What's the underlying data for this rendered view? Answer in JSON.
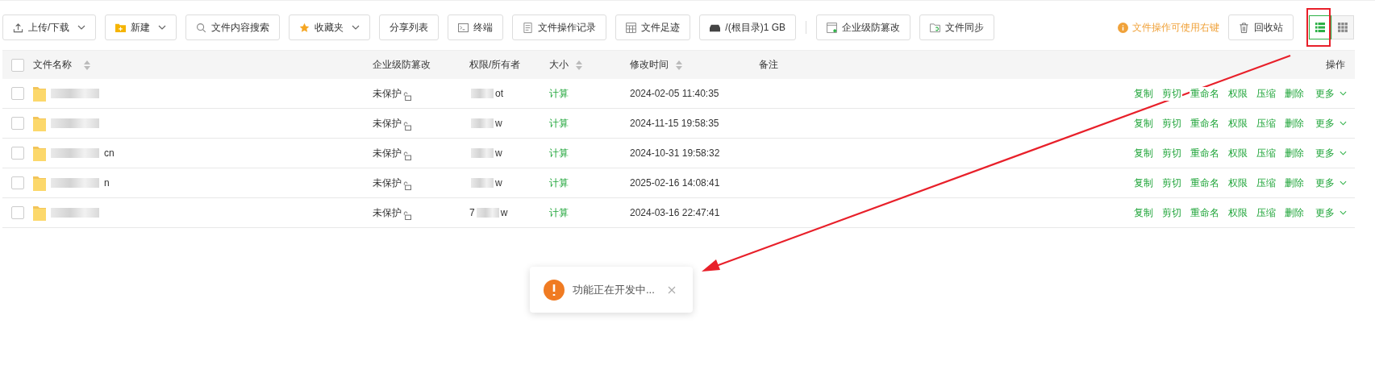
{
  "toolbar": {
    "buttons": [
      {
        "label": "上传/下载",
        "caret": true,
        "divider_before": false
      },
      {
        "label": "新建",
        "caret": true,
        "divider_before": false
      },
      {
        "label": "文件内容搜索",
        "caret": false,
        "divider_before": false
      },
      {
        "label": "收藏夹",
        "caret": true,
        "divider_before": false
      },
      {
        "label": "分享列表",
        "caret": false,
        "divider_before": false
      },
      {
        "label": "终端",
        "caret": false,
        "divider_before": false
      },
      {
        "label": "文件操作记录",
        "caret": false,
        "divider_before": false
      },
      {
        "label": "文件足迹",
        "caret": false,
        "divider_before": false
      },
      {
        "label": "/(根目录)1 GB",
        "caret": false,
        "divider_before": false
      },
      {
        "label": "企业级防篡改",
        "caret": false,
        "divider_before": true
      },
      {
        "label": "文件同步",
        "caret": false,
        "divider_before": false
      }
    ],
    "hint": "文件操作可使用右键",
    "recycle": "回收站",
    "views": [
      {
        "kind": "list",
        "selected": true
      },
      {
        "kind": "grid",
        "selected": false
      }
    ]
  },
  "table": {
    "all_checked": false,
    "columns": [
      {
        "label": "文件名称",
        "sortable": true
      },
      {
        "label": "企业级防篡改",
        "sortable": false
      },
      {
        "label": "权限/所有者",
        "sortable": false
      },
      {
        "label": "大小",
        "sortable": true
      },
      {
        "label": "修改时间",
        "sortable": true
      },
      {
        "label": "备注",
        "sortable": false
      },
      {
        "label": "操作",
        "sortable": false
      }
    ],
    "rows": [
      {
        "checked": false,
        "name_tail": "",
        "protect": "未保护",
        "owner_head": "",
        "owner_tail": "ot",
        "size": "计算",
        "mtime": "2024-02-05 11:40:35",
        "actions": [
          "复制",
          "剪切",
          "重命名",
          "权限",
          "压缩",
          "删除"
        ],
        "more": "更多"
      },
      {
        "checked": false,
        "name_tail": "",
        "protect": "未保护",
        "owner_head": "",
        "owner_tail": "w",
        "size": "计算",
        "mtime": "2024-11-15 19:58:35",
        "actions": [
          "复制",
          "剪切",
          "重命名",
          "权限",
          "压缩",
          "删除"
        ],
        "more": "更多"
      },
      {
        "checked": false,
        "name_tail": "cn",
        "protect": "未保护",
        "owner_head": "",
        "owner_tail": "w",
        "size": "计算",
        "mtime": "2024-10-31 19:58:32",
        "actions": [
          "复制",
          "剪切",
          "重命名",
          "权限",
          "压缩",
          "删除"
        ],
        "more": "更多"
      },
      {
        "checked": false,
        "name_tail": "n",
        "protect": "未保护",
        "owner_head": "",
        "owner_tail": "w",
        "size": "计算",
        "mtime": "2025-02-16 14:08:41",
        "actions": [
          "复制",
          "剪切",
          "重命名",
          "权限",
          "压缩",
          "删除"
        ],
        "more": "更多"
      },
      {
        "checked": false,
        "name_tail": "",
        "protect": "未保护",
        "owner_head": "7",
        "owner_tail": "w",
        "size": "计算",
        "mtime": "2024-03-16 22:47:41",
        "actions": [
          "复制",
          "剪切",
          "重命名",
          "权限",
          "压缩",
          "删除"
        ],
        "more": "更多"
      }
    ]
  },
  "toast": {
    "kind": "warning",
    "message": "功能正在开发中..."
  }
}
